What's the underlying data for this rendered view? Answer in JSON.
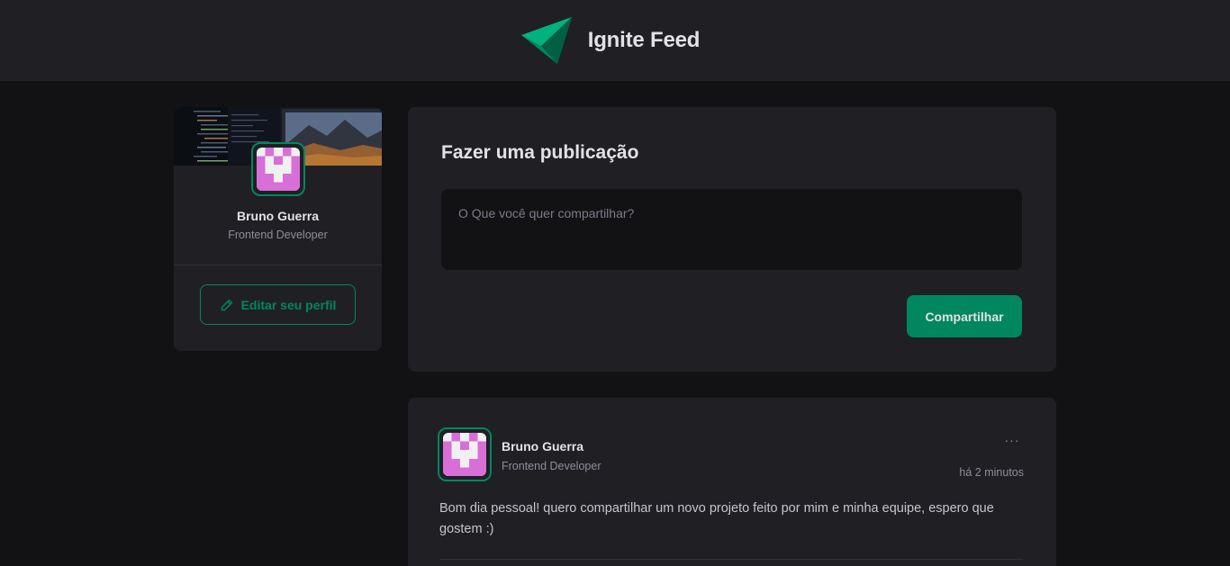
{
  "header": {
    "brand_title": "Ignite Feed",
    "logo_icon": "ignite-logo-icon"
  },
  "sidebar": {
    "cover_image": "code-workspace-cover",
    "avatar_icon": "pixel-avatar-icon",
    "name": "Bruno Guerra",
    "role": "Frontend Developer",
    "edit_button_label": "Editar seu perfil",
    "edit_icon": "pencil-icon"
  },
  "composer": {
    "title": "Fazer uma publicação",
    "placeholder": "O Que você quer compartilhar?",
    "share_button_label": "Compartilhar"
  },
  "post": {
    "author_name": "Bruno Guerra",
    "author_role": "Frontend Developer",
    "published_at": "há 2 minutos",
    "menu_label": "···",
    "content": "Bom dia pessoal! quero compartilhar um novo projeto feito por mim e minha equipe, espero que gostem :)"
  },
  "colors": {
    "background": "#121214",
    "surface": "#202024",
    "accent": "#00875f",
    "text": "#e1e1e6",
    "muted": "#8d8d99",
    "avatar_pink": "#d86fd8"
  }
}
